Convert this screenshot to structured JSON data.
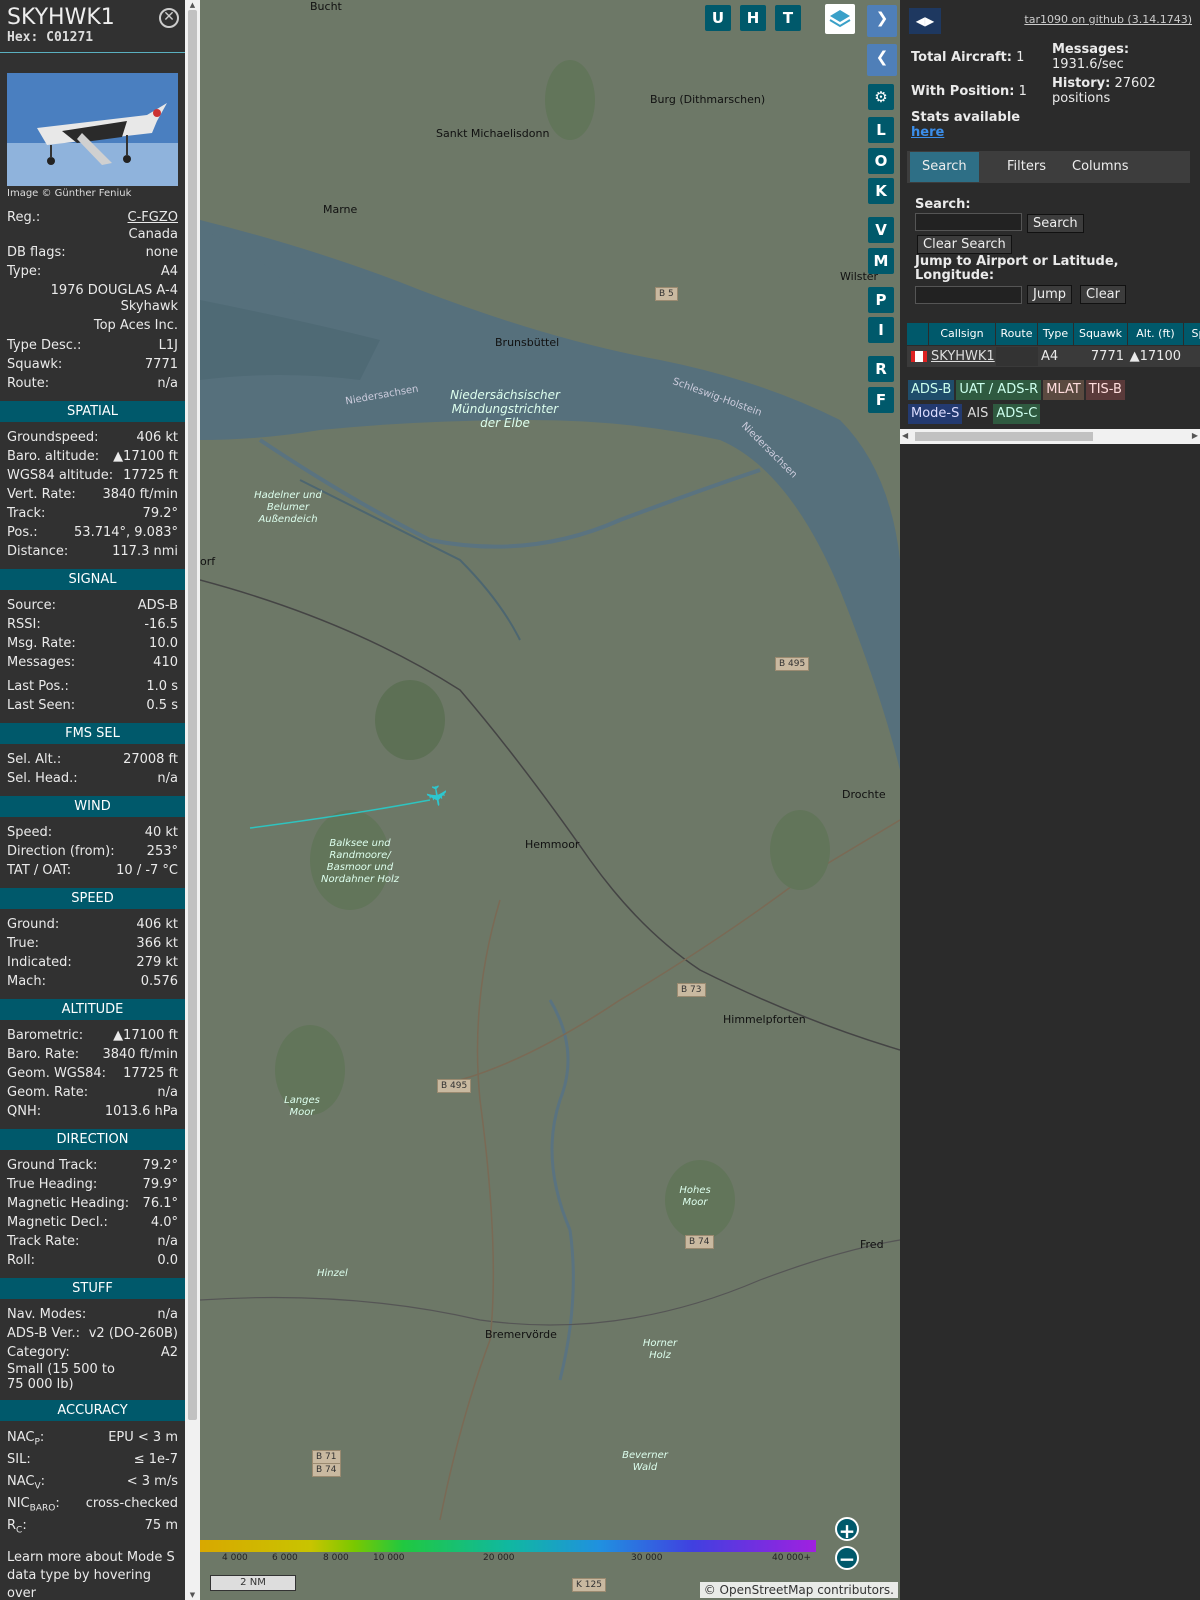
{
  "left": {
    "callsign": "SKYHWK1",
    "hex": "Hex: C01271",
    "photo_credit": "Image © Günther Feniuk",
    "reg_label": "Reg.:",
    "reg": "C-FGZO",
    "country": "Canada",
    "dbflags_label": "DB flags:",
    "dbflags": "none",
    "type_label": "Type:",
    "type": "A4",
    "model": "1976 DOUGLAS A-4 Skyhawk",
    "operator": "Top Aces Inc.",
    "typedesc_label": "Type Desc.:",
    "typedesc": "L1J",
    "squawk_label": "Squawk:",
    "squawk": "7771",
    "route_label": "Route:",
    "route": "n/a",
    "sections": {
      "spatial": "SPATIAL",
      "signal": "SIGNAL",
      "fms": "FMS SEL",
      "wind": "WIND",
      "speed": "SPEED",
      "altitude": "ALTITUDE",
      "direction": "DIRECTION",
      "stuff": "STUFF",
      "accuracy": "ACCURACY"
    },
    "spatial": [
      [
        "Groundspeed:",
        "406 kt"
      ],
      [
        "Baro. altitude:",
        "▲17100 ft"
      ],
      [
        "WGS84 altitude:",
        "17725 ft"
      ],
      [
        "Vert. Rate:",
        "3840 ft/min"
      ],
      [
        "Track:",
        "79.2°"
      ],
      [
        "Pos.:",
        "53.714°, 9.083°"
      ],
      [
        "Distance:",
        "117.3 nmi"
      ]
    ],
    "signal": [
      [
        "Source:",
        "ADS-B"
      ],
      [
        "RSSI:",
        "-16.5"
      ],
      [
        "Msg. Rate:",
        "10.0"
      ],
      [
        "Messages:",
        "410"
      ],
      [
        "Last Pos.:",
        "1.0 s"
      ],
      [
        "Last Seen:",
        "0.5 s"
      ]
    ],
    "fms": [
      [
        "Sel. Alt.:",
        "27008 ft"
      ],
      [
        "Sel. Head.:",
        "n/a"
      ]
    ],
    "wind": [
      [
        "Speed:",
        "40 kt"
      ],
      [
        "Direction (from):",
        "253°"
      ],
      [
        "TAT / OAT:",
        "10 / -7 °C"
      ]
    ],
    "speed": [
      [
        "Ground:",
        "406 kt"
      ],
      [
        "True:",
        "366 kt"
      ],
      [
        "Indicated:",
        "279 kt"
      ],
      [
        "Mach:",
        "0.576"
      ]
    ],
    "altitude": [
      [
        "Barometric:",
        "▲17100 ft"
      ],
      [
        "Baro. Rate:",
        "3840 ft/min"
      ],
      [
        "Geom. WGS84:",
        "17725 ft"
      ],
      [
        "Geom. Rate:",
        "n/a"
      ],
      [
        "QNH:",
        "1013.6 hPa"
      ]
    ],
    "direction": [
      [
        "Ground Track:",
        "79.2°"
      ],
      [
        "True Heading:",
        "79.9°"
      ],
      [
        "Magnetic Heading:",
        "76.1°"
      ],
      [
        "Magnetic Decl.:",
        "4.0°"
      ],
      [
        "Track Rate:",
        "n/a"
      ],
      [
        "Roll:",
        "0.0"
      ]
    ],
    "stuff": [
      [
        "Nav. Modes:",
        "n/a"
      ],
      [
        "ADS-B Ver.:",
        "v2 (DO-260B)"
      ],
      [
        "Category:",
        "A2"
      ]
    ],
    "stuff_size": "Small (15 500 to 75 000 lb)",
    "accuracy": [
      [
        "NAC",
        "P",
        ":",
        "EPU < 3 m"
      ],
      [
        "SIL:",
        "",
        "",
        "≤ 1e-7"
      ],
      [
        "NAC",
        "V",
        ":",
        "< 3 m/s"
      ],
      [
        "NIC",
        "BARO",
        ":",
        "cross-checked"
      ],
      [
        "R",
        "C",
        ":",
        "75 m"
      ]
    ],
    "footer": "Learn more about Mode S data type by hovering over"
  },
  "map": {
    "buttons_top": [
      "U",
      "H",
      "T"
    ],
    "side_buttons": [
      "L",
      "O",
      "K",
      "V",
      "M",
      "P",
      "I",
      "R",
      "F"
    ],
    "places": [
      [
        "Burg (Dithmarschen)"
      ],
      [
        "Sankt Michaelisdonn"
      ],
      [
        "Marne"
      ],
      [
        "Brunsbüttel"
      ],
      [
        "Niedersächsischer Mündungstrichter der Elbe"
      ],
      [
        "Hemmoor"
      ],
      [
        "Drochte"
      ],
      [
        "Himmelpforten"
      ],
      [
        "Bremervörde"
      ],
      [
        "Balksee und Randmoore/ Basmoor und Nordahner Holz"
      ],
      [
        "Hadelner und Belumer Außendeich"
      ],
      [
        "Langes Moor"
      ],
      [
        "Hohes Moor"
      ],
      [
        "Horner Holz"
      ],
      [
        "Beverner Wald"
      ],
      [
        "Hinzel"
      ],
      [
        "Wilster"
      ],
      [
        "Bucht"
      ],
      [
        "Fred"
      ],
      [
        "orf"
      ]
    ],
    "roads": [
      "B 5",
      "B 495",
      "B 73",
      "B 495",
      "B 74",
      "B 71",
      "B 74",
      "K 125"
    ],
    "rivers": [
      "Niedersachsen",
      "Schleswig-Holstein",
      "Niedersachsen"
    ],
    "legend_ticks": [
      "4 000",
      "6 000",
      "8 000",
      "10 000",
      "20 000",
      "30 000",
      "40 000+"
    ],
    "scale": "2 NM",
    "attribution": "© OpenStreetMap contributors."
  },
  "right": {
    "github": "tar1090 on github (3.14.1743)",
    "total_label": "Total Aircraft:",
    "total": "1",
    "withpos_label": "With Position:",
    "withpos": "1",
    "messages_label": "Messages:",
    "messages": "1931.6/sec",
    "history_label": "History:",
    "history": "27602 positions",
    "stats_label": "Stats available",
    "stats_link": "here",
    "tabs": [
      "Search",
      "Filters",
      "Columns"
    ],
    "search_label": "Search:",
    "search_btn": "Search",
    "clear_search_btn": "Clear Search",
    "jump_label": "Jump to Airport or Latitude, Longitude:",
    "jump_btn": "Jump",
    "clear_btn": "Clear",
    "table_headers": [
      "Callsign",
      "Route",
      "Type",
      "Squawk",
      "Alt. (ft)",
      "Sp"
    ],
    "table_row": {
      "callsign": "SKYHWK1",
      "route": "",
      "type": "A4",
      "squawk": "7771",
      "alt": "▲17100"
    },
    "source_tags": [
      "ADS-B",
      "UAT / ADS-R",
      "MLAT",
      "TIS-B",
      "Mode-S",
      "AIS",
      "ADS-C"
    ]
  }
}
